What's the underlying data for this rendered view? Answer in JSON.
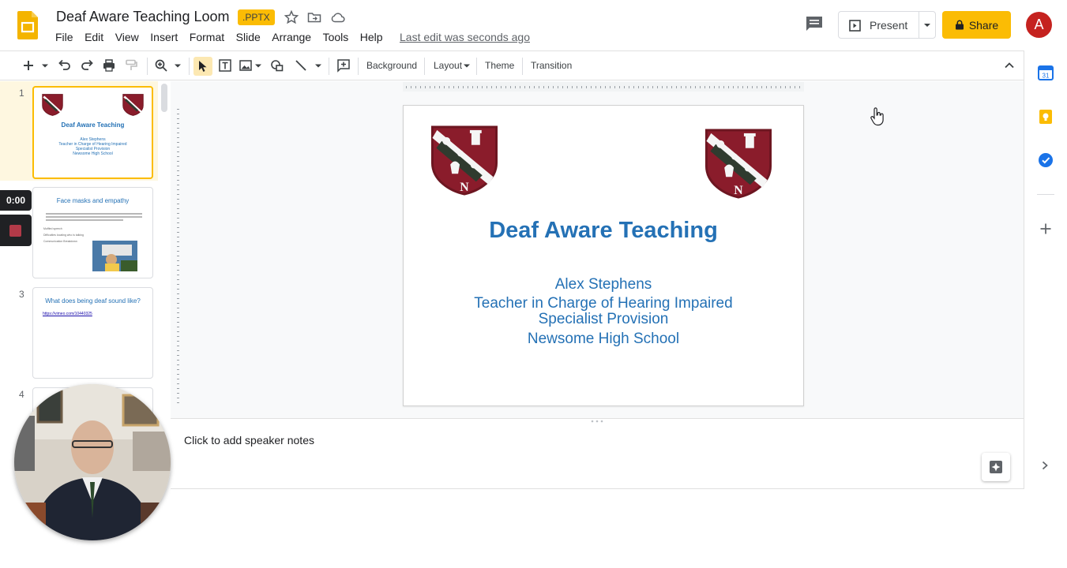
{
  "header": {
    "title": "Deaf Aware Teaching Loom",
    "badge": ".PPTX",
    "last_edit": "Last edit was seconds ago",
    "menu": [
      "File",
      "Edit",
      "View",
      "Insert",
      "Format",
      "Slide",
      "Arrange",
      "Tools",
      "Help"
    ],
    "present_label": "Present",
    "share_label": "Share",
    "avatar_initial": "A"
  },
  "toolbar": {
    "background_label": "Background",
    "layout_label": "Layout",
    "theme_label": "Theme",
    "transition_label": "Transition"
  },
  "filmstrip": {
    "slides": [
      {
        "number": "1",
        "title": "Deaf Aware Teaching",
        "lines": [
          "Alex Stephens",
          "Teacher in Charge of Hearing Impaired",
          "Specialist Provision",
          "Newsome High School"
        ]
      },
      {
        "number": "2",
        "title": "Face masks and empathy",
        "bullets": [
          "Muffled speech",
          "Difficulties locating who is talking",
          "Communication Breakdown"
        ]
      },
      {
        "number": "3",
        "title": "What does being deaf sound like?",
        "link": "https://vimeo.com/10440325"
      },
      {
        "number": "4"
      }
    ]
  },
  "slide": {
    "title": "Deaf Aware Teaching",
    "subtitle_lines": [
      "Alex Stephens",
      "Teacher in Charge of Hearing Impaired",
      "Specialist Provision",
      "Newsome High School"
    ]
  },
  "notes": {
    "placeholder": "Click to add speaker notes"
  },
  "loom": {
    "timer": "0:00"
  },
  "colors": {
    "accent_yellow": "#fbbc04",
    "slide_text_blue": "#2471b5",
    "avatar_red": "#c5221f",
    "crest_maroon": "#8a1c2b"
  }
}
